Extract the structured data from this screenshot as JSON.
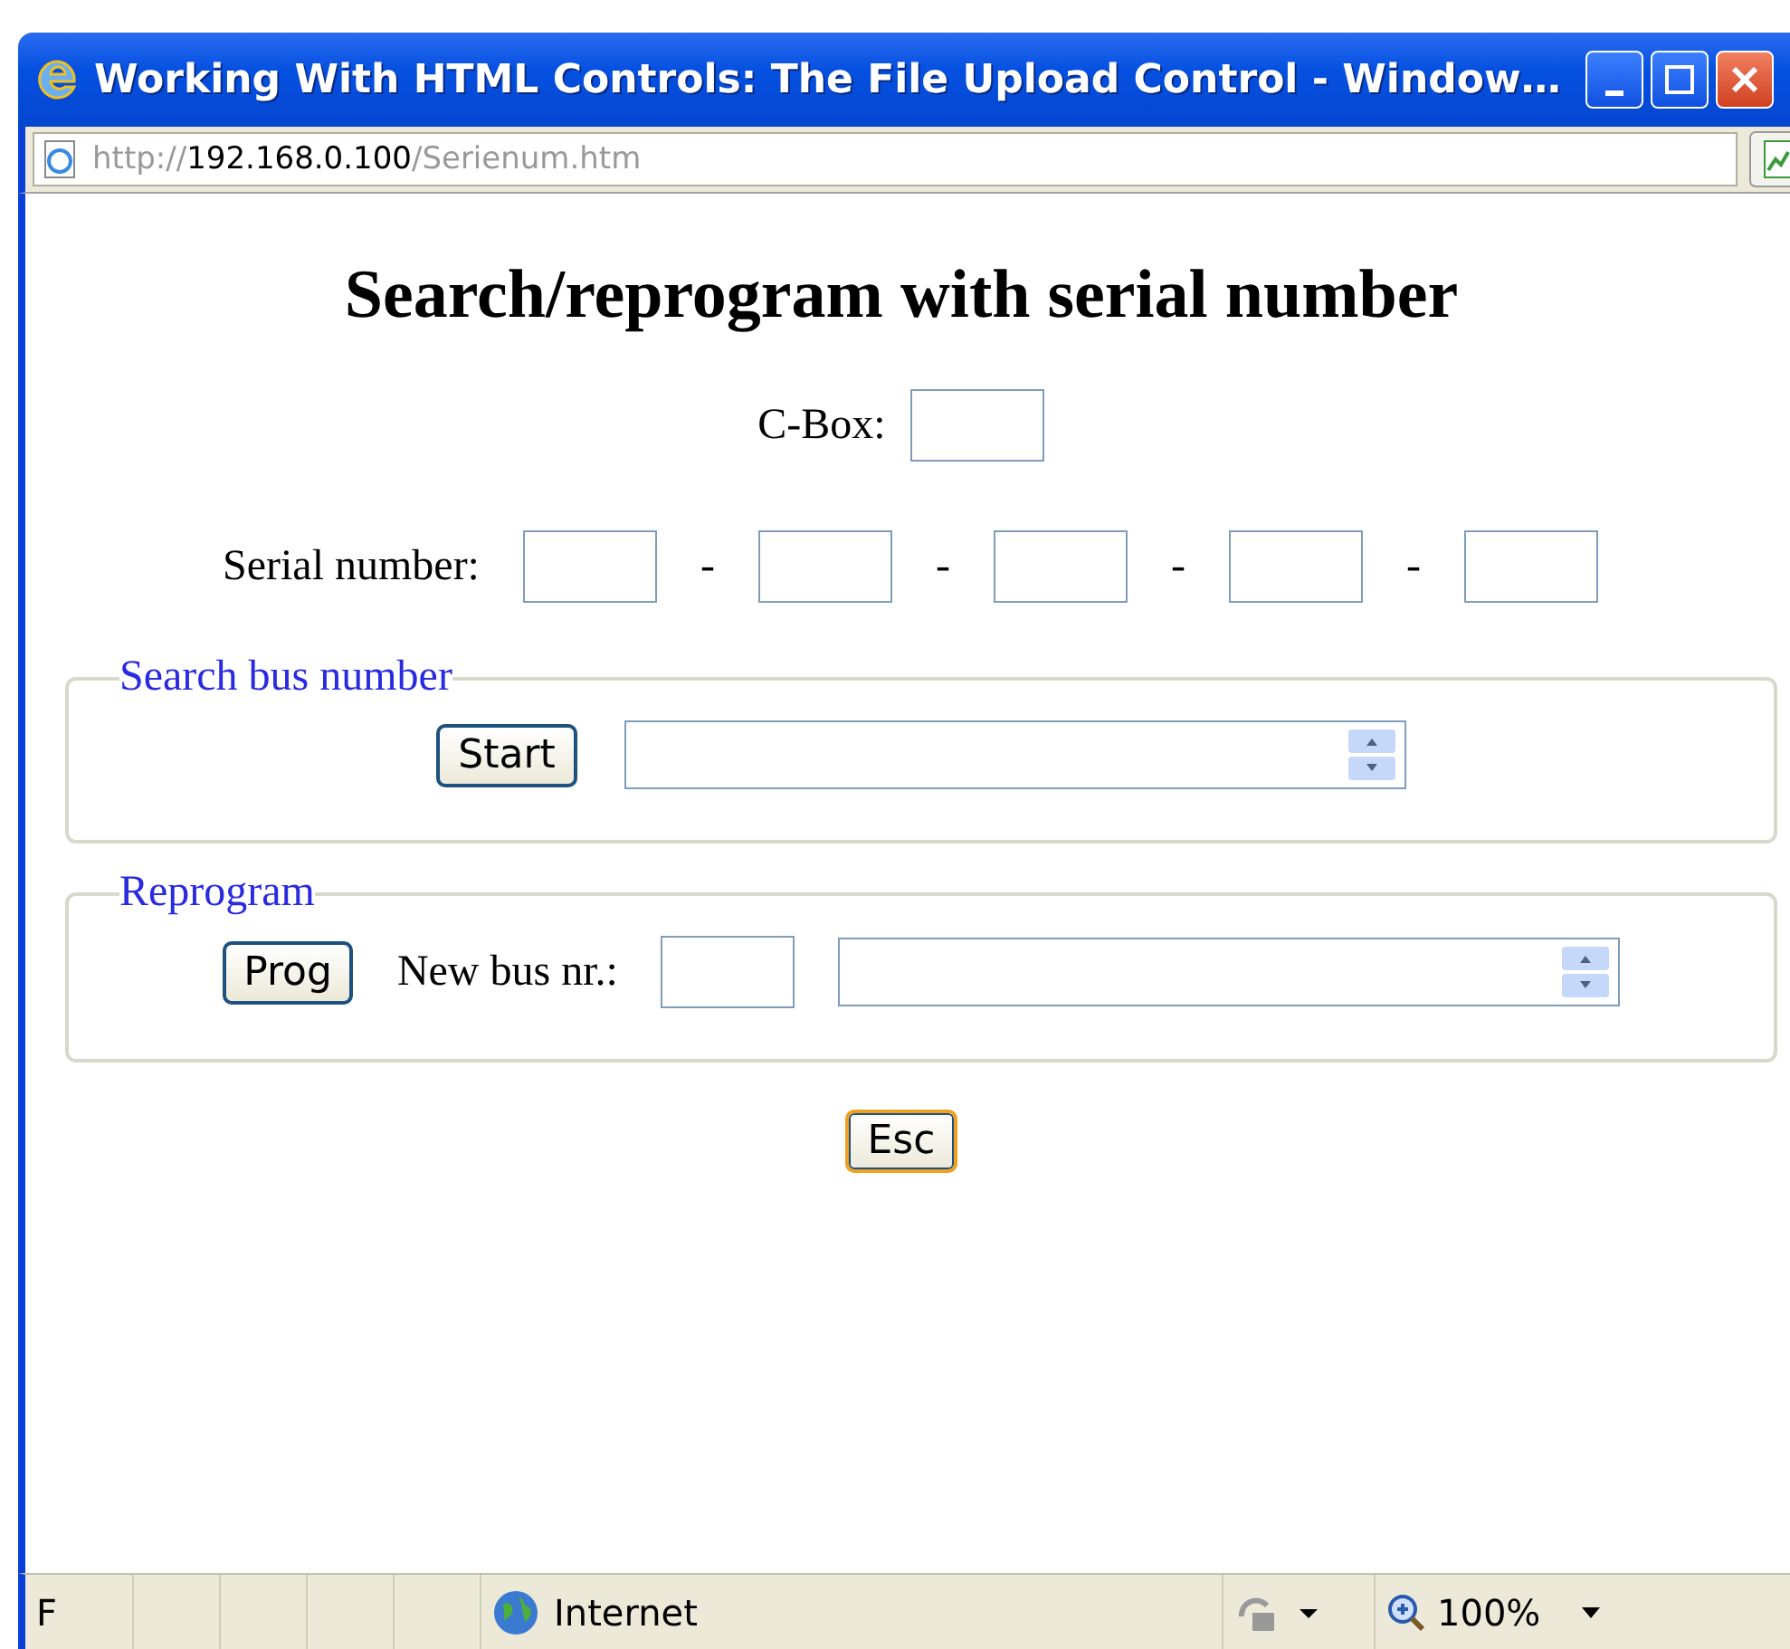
{
  "window": {
    "title": "Working With HTML Controls: The File Upload Control - Window…"
  },
  "address": {
    "scheme": "http://",
    "host": "192.168.0.100",
    "path": "/Serienum.htm"
  },
  "heading": "Search/reprogram with serial number",
  "cbox": {
    "label": "C-Box:"
  },
  "serial": {
    "label": "Serial number:",
    "separators": [
      "-",
      "-",
      "-",
      "-"
    ]
  },
  "search_group": {
    "legend": "Search bus number",
    "button": {
      "label": "Start",
      "focused": false
    }
  },
  "reprogram_group": {
    "legend": "Reprogram",
    "button": {
      "label": "Prog",
      "focused": false
    },
    "field_label": "New bus nr.:"
  },
  "esc_button": {
    "label": "Esc",
    "focused": true
  },
  "status_bar": {
    "first_pane": "F",
    "zone": "Internet",
    "zoom": "100%"
  }
}
